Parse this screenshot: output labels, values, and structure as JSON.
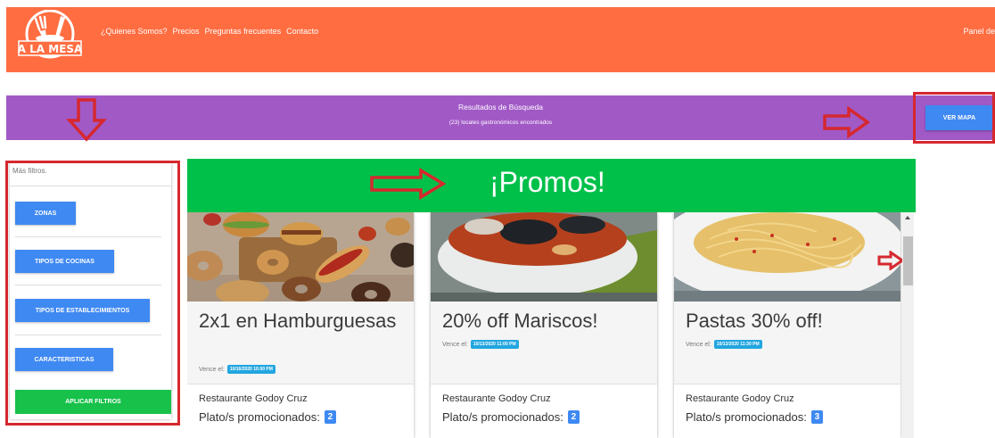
{
  "header": {
    "brand": "A LA MESA",
    "nav": [
      "¿Quienes Somos?",
      "Precios",
      "Preguntas frecuentes",
      "Contacto"
    ],
    "panel_label": "Panel de",
    "colors": {
      "header_bg": "#ff6d41"
    }
  },
  "search": {
    "title": "Resultados de Búsqueda",
    "subtitle": "(23) locales gastronómicos encontrados",
    "map_button": "VER MAPA",
    "colors": {
      "band_bg": "#a159c6"
    }
  },
  "filters": {
    "title": "Más filtros.",
    "buttons": [
      "ZONAS",
      "TIPOS DE COCINAS",
      "TIPOS DE ESTABLECIMIENTOS",
      "CARACTERISTICAS"
    ],
    "apply": "APLICAR FILTROS"
  },
  "promos": {
    "heading": "¡Promos!",
    "colors": {
      "band_bg": "#00c04a"
    },
    "cards": [
      {
        "title": "2x1 en Hamburguesas",
        "expires_label": "Vence el:",
        "expires": "10/16/2020 10:00 PM",
        "restaurant": "Restaurante Godoy Cruz",
        "plates_label": "Plato/s promocionados:",
        "plates_count": "2"
      },
      {
        "title": "20% off Mariscos!",
        "expires_label": "Vence el:",
        "expires": "10/13/2020 11:00 PM",
        "restaurant": "Restaurante Godoy Cruz",
        "plates_label": "Plato/s promocionados:",
        "plates_count": "2"
      },
      {
        "title": "Pastas 30% off!",
        "expires_label": "Vence el:",
        "expires": "10/13/2020 11:30 PM",
        "restaurant": "Restaurante Godoy Cruz",
        "plates_label": "Plato/s promocionados:",
        "plates_count": "3"
      }
    ]
  },
  "annotation": {
    "colors": {
      "red": "#d6282f"
    }
  }
}
